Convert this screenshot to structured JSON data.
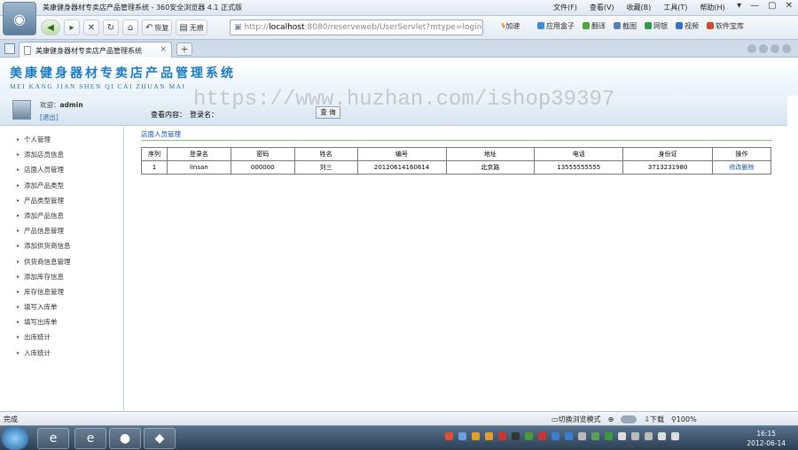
{
  "window": {
    "title": "美康健身器材专卖店产品管理系统 - 360安全浏览器 4.1 正式版",
    "menu": [
      "文件(F)",
      "查看(V)",
      "收藏(B)",
      "工具(T)",
      "帮助(H)"
    ],
    "controls": [
      "▾",
      "—",
      "▢",
      "✕"
    ]
  },
  "toolbar": {
    "back_icon": "◀",
    "forward_icon": "▸",
    "stop_icon": "✕",
    "refresh_icon": "↻",
    "home_icon": "⌂",
    "restore_label": "恢复",
    "fit_label": "无痕",
    "address": {
      "protocol": "http://",
      "host": "localhost",
      "rest": ":8080/reserveweb/UserServlet?mtype=login"
    },
    "speed_label": "加速",
    "extensions": [
      "应用盒子",
      "翻译",
      "截图",
      "网银",
      "视频",
      "软件宝库"
    ]
  },
  "tabs": [
    {
      "label": "美康健身器材专卖店产品管理系统",
      "close": "×"
    }
  ],
  "newtab_label": "+",
  "app": {
    "title": "美康健身器材专卖店产品管理系统",
    "subtitle": "MEI KANG JIAN SHEN QI CAI ZHUAN MAI",
    "watermark": "https://www.huzhan.com/ishop39397",
    "user": {
      "greeting_prefix": "欢迎：",
      "name": "admin",
      "logout": "[退出]"
    },
    "search": {
      "label": "查看内容：",
      "field_label": "登录名：",
      "value": "",
      "button": "查 询"
    },
    "sidebar": [
      "个人管理",
      "添加店员信息",
      "店面人员管理",
      "添加产品类型",
      "产品类型管理",
      "添加产品信息",
      "产品信息管理",
      "添加供货商信息",
      "供货商信息管理",
      "添加库存信息",
      "库存信息管理",
      "填写入库单",
      "填写出库单",
      "出库统计",
      "入库统计"
    ],
    "section_title": "店面人员管理",
    "table": {
      "headers": [
        "序列",
        "登录名",
        "密码",
        "姓名",
        "编号",
        "地址",
        "电话",
        "身份证",
        "操作"
      ],
      "rows": [
        {
          "cells": [
            "1",
            "linsan",
            "000000",
            "刘三",
            "20120614160614",
            "北京路",
            "13555555555",
            "3713231980"
          ],
          "edit": "修改",
          "delete": "删除"
        }
      ]
    }
  },
  "statusbar": {
    "text": "完成",
    "compat": "切换浏览模式",
    "download": "下载",
    "zoom": "100%"
  },
  "taskbar": {
    "time": "16:15",
    "date": "2012-06-14"
  }
}
